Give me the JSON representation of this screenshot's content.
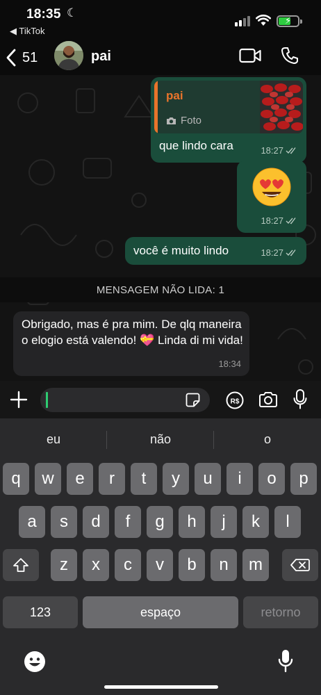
{
  "status": {
    "time": "18:35",
    "back_app": "◀ TikTok"
  },
  "header": {
    "back_count": "51",
    "contact_name": "pai"
  },
  "messages": [
    {
      "quote_name": "pai",
      "quote_type": "Foto",
      "text": "que lindo cara",
      "time": "18:27"
    },
    {
      "emoji": "heart-eyes",
      "time": "18:27"
    },
    {
      "text": "você é muito lindo",
      "time": "18:27"
    },
    {
      "text": "Obrigado, mas é pra mim. De qlq maneira o elogio está valendo! 💝 Linda di mi vida!",
      "time": "18:34"
    }
  ],
  "unread_banner": "MENSAGEM NÃO LIDA: 1",
  "keyboard": {
    "suggestions": [
      "eu",
      "não",
      "o"
    ],
    "row1": [
      "q",
      "w",
      "e",
      "r",
      "t",
      "y",
      "u",
      "i",
      "o",
      "p"
    ],
    "row2": [
      "a",
      "s",
      "d",
      "f",
      "g",
      "h",
      "j",
      "k",
      "l"
    ],
    "row3": [
      "z",
      "x",
      "c",
      "v",
      "b",
      "n",
      "m"
    ],
    "numbers_label": "123",
    "space_label": "espaço",
    "return_label": "retorno"
  },
  "colors": {
    "outgoing_bubble": "#1a4d3b",
    "incoming_bubble": "#242426",
    "quote_accent": "#e9742b",
    "battery": "#2ecc40"
  }
}
